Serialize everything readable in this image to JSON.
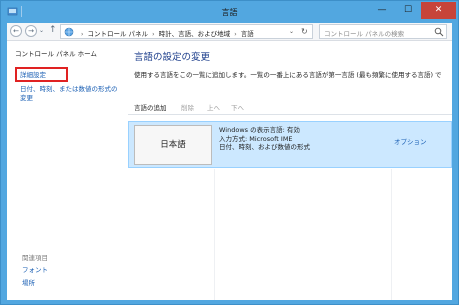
{
  "window": {
    "title": "言語",
    "minimize": "—",
    "maximize": "☐",
    "close": "✕"
  },
  "addressbar": {
    "back": "←",
    "forward": "→",
    "dropdown": "⌄",
    "up": "↑",
    "crumbs": [
      "コントロール パネル",
      "時計、言語、および地域",
      "言語"
    ],
    "separator": "›",
    "refresh": "↻",
    "search_placeholder": "コントロール パネルの検索"
  },
  "left": {
    "home": "コントロール パネル ホーム",
    "advanced": "詳細設定",
    "datetime": "日付、時刻、または数値の形式の変更",
    "related_title": "関連項目",
    "related_items": [
      "フォント",
      "場所"
    ]
  },
  "main": {
    "title": "言語の設定の変更",
    "description": "使用する言語をこの一覧に追加します。一覧の一番上にある言語が第一言語 (最も頻繁に使用する言語) で",
    "toolbar": {
      "add": "言語の追加",
      "remove": "削除",
      "up": "上へ",
      "down": "下へ"
    },
    "languages": [
      {
        "name": "日本語",
        "line1": "Windows の表示言語: 有効",
        "line2": "入力方式: Microsoft IME",
        "line3": "日付、時刻、および数値の形式",
        "options": "オプション"
      }
    ]
  },
  "colors": {
    "accent": "#52a7e0",
    "link": "#1a5fb4",
    "highlight_box": "#e02222",
    "selected_row": "#cce8ff"
  }
}
